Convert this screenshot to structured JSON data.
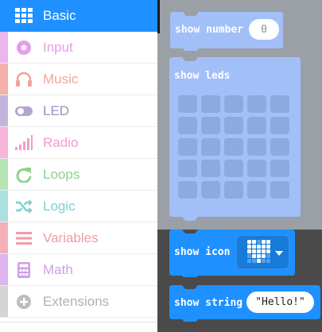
{
  "colors": {
    "basic": "#1e90ff",
    "input": "#d400d4",
    "music": "#e63022",
    "led": "#5c2d91",
    "radio": "#e3008c",
    "loops": "#00aa00",
    "logic": "#00a4a6",
    "variables": "#dc143c",
    "math": "#9400d3",
    "extensions": "#7f7f7f",
    "block_faded": "#a3bff8",
    "block_active": "#1e90ff"
  },
  "categories": [
    {
      "key": "basic",
      "label": "Basic",
      "icon": "grid-icon",
      "selected": true
    },
    {
      "key": "input",
      "label": "Input",
      "icon": "circle-dot-icon",
      "selected": false
    },
    {
      "key": "music",
      "label": "Music",
      "icon": "headphones-icon",
      "selected": false
    },
    {
      "key": "led",
      "label": "LED",
      "icon": "toggle-icon",
      "selected": false
    },
    {
      "key": "radio",
      "label": "Radio",
      "icon": "signal-bars-icon",
      "selected": false
    },
    {
      "key": "loops",
      "label": "Loops",
      "icon": "refresh-icon",
      "selected": false
    },
    {
      "key": "logic",
      "label": "Logic",
      "icon": "shuffle-icon",
      "selected": false
    },
    {
      "key": "variables",
      "label": "Variables",
      "icon": "list-lines-icon",
      "selected": false
    },
    {
      "key": "math",
      "label": "Math",
      "icon": "calculator-icon",
      "selected": false
    },
    {
      "key": "extensions",
      "label": "Extensions",
      "icon": "plus-circle-icon",
      "selected": false
    }
  ],
  "flyout": {
    "show_number": {
      "label": "show number",
      "value": "0"
    },
    "show_leds": {
      "label": "show leds"
    },
    "show_icon": {
      "label": "show icon",
      "icon": "heart-icon",
      "dropdown_icon": "caret-down-icon"
    },
    "show_string": {
      "label": "show string",
      "value": "\"Hello!\""
    }
  }
}
